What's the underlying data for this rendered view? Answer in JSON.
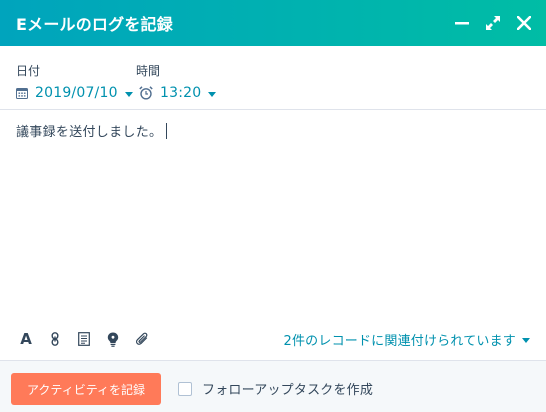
{
  "dialog": {
    "title": "Eメールのログを記録"
  },
  "fields": {
    "date_label": "日付",
    "date_value": "2019/07/10",
    "time_label": "時間",
    "time_value": "13:20"
  },
  "editor": {
    "text": "議事録を送付しました。"
  },
  "toolbar": {
    "icons": [
      "text-format-icon",
      "link-icon",
      "snippet-icon",
      "lightbulb-icon",
      "attachment-icon"
    ],
    "associations_text": "2件のレコードに関連付けられています"
  },
  "footer": {
    "primary_button": "アクティビティを記録",
    "followup_checkbox_label": "フォローアップタスクを作成",
    "followup_checked": false
  },
  "colors": {
    "header_gradient_start": "#00a4bd",
    "header_gradient_end": "#00bda5",
    "link": "#0091ae",
    "primary_button": "#ff7a59",
    "text": "#33475b"
  }
}
